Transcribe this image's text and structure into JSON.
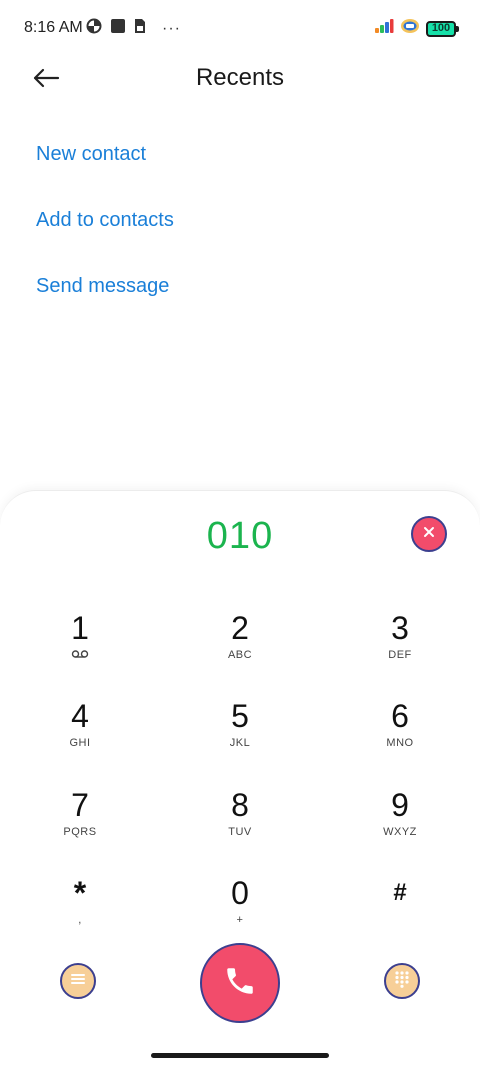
{
  "status_bar": {
    "time": "8:16 AM",
    "more": "···",
    "battery_level": "100",
    "icons": [
      "data-saver-icon",
      "stop-square-icon",
      "sim-card-icon",
      "signal-bars-icon",
      "vpn-shield-icon",
      "battery-icon"
    ]
  },
  "header": {
    "title": "Recents",
    "back_icon": "arrow-left-icon"
  },
  "actions": {
    "new_contact": "New contact",
    "add_to_contacts": "Add to contacts",
    "send_message": "Send message"
  },
  "dialer": {
    "number": "010",
    "keys": [
      {
        "digit": "1",
        "letters": ""
      },
      {
        "digit": "2",
        "letters": "ABC"
      },
      {
        "digit": "3",
        "letters": "DEF"
      },
      {
        "digit": "4",
        "letters": "GHI"
      },
      {
        "digit": "5",
        "letters": "JKL"
      },
      {
        "digit": "6",
        "letters": "MNO"
      },
      {
        "digit": "7",
        "letters": "PQRS"
      },
      {
        "digit": "8",
        "letters": "TUV"
      },
      {
        "digit": "9",
        "letters": "WXYZ"
      },
      {
        "digit": "*",
        "letters": ","
      },
      {
        "digit": "0",
        "letters": "+"
      },
      {
        "digit": "#",
        "letters": ""
      }
    ]
  },
  "colors": {
    "accent_link": "#1a7fd8",
    "number_green": "#1bb44e",
    "call_red": "#f24c6b",
    "side_button": "#f7cf98",
    "outline": "#3c3f8f"
  }
}
